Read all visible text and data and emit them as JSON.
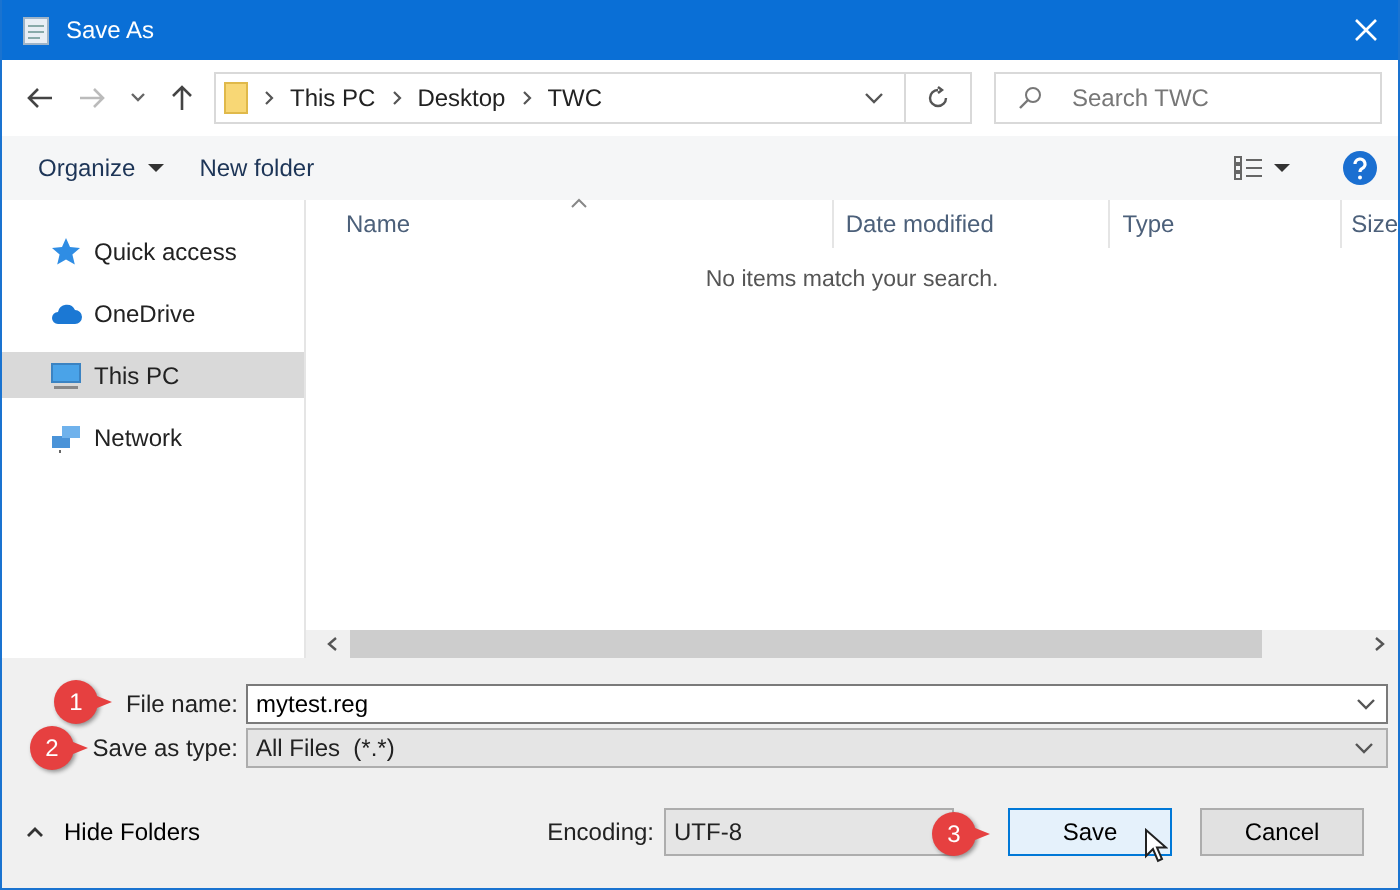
{
  "window": {
    "title": "Save As"
  },
  "breadcrumb": [
    "This PC",
    "Desktop",
    "TWC"
  ],
  "search": {
    "placeholder": "Search TWC"
  },
  "toolbar": {
    "organize": "Organize",
    "new_folder": "New folder"
  },
  "sidebar": {
    "items": [
      {
        "label": "Quick access",
        "kind": "star",
        "selected": false
      },
      {
        "label": "OneDrive",
        "kind": "cloud",
        "selected": false
      },
      {
        "label": "This PC",
        "kind": "pc",
        "selected": true
      },
      {
        "label": "Network",
        "kind": "network",
        "selected": false
      }
    ]
  },
  "table": {
    "columns": [
      "Name",
      "Date modified",
      "Type",
      "Size"
    ],
    "empty_message": "No items match your search."
  },
  "fields": [
    {
      "label": "File name:",
      "value": "mytest.reg",
      "kind": "input",
      "callout": "1"
    },
    {
      "label": "Save as type:",
      "value": "All Files  (*.*)",
      "kind": "select",
      "callout": "2"
    }
  ],
  "footer": {
    "toggle": "Hide Folders",
    "encoding_label": "Encoding:",
    "encoding": "UTF-8",
    "buttons": [
      {
        "label": "Save",
        "default": true,
        "callout": "3"
      },
      {
        "label": "Cancel",
        "default": false
      }
    ]
  }
}
